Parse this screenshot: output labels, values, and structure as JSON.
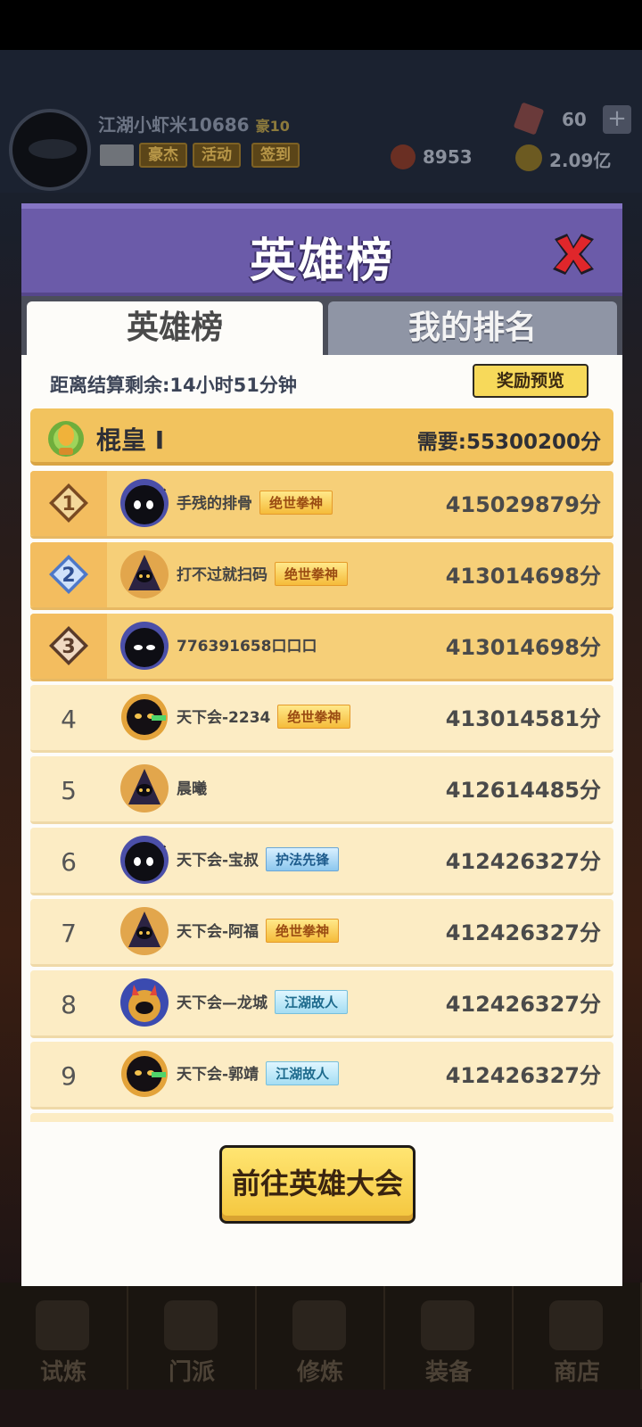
{
  "background": {
    "player_name": "江湖小虾米10686",
    "vip": "豪10",
    "tags": [
      "豪杰",
      "活动",
      "签到"
    ],
    "gems": "60",
    "red_currency": "8953",
    "gold": "2.09亿",
    "nav": [
      "试炼",
      "门派",
      "修炼",
      "装备",
      "商店"
    ]
  },
  "modal": {
    "title": "英雄榜",
    "tabs": {
      "active": "英雄榜",
      "inactive": "我的排名"
    },
    "countdown": "距离结算剩余:14小时51分钟",
    "preview_button": "奖励预览",
    "tier": {
      "name": "棍皇 I",
      "requirement": "需要:55300200分"
    },
    "rows": [
      {
        "rank": "1",
        "name": "手残的排骨",
        "title": "绝世拳神",
        "title_style": "gold",
        "score": "415029879分",
        "avatar": "ninja-question"
      },
      {
        "rank": "2",
        "name": "打不过就扫码",
        "title": "绝世拳神",
        "title_style": "gold",
        "score": "413014698分",
        "avatar": "hooded"
      },
      {
        "rank": "3",
        "name": "776391658口口口",
        "title": "",
        "title_style": "",
        "score": "413014698分",
        "avatar": "ninja"
      },
      {
        "rank": "4",
        "name": "天下会-2234",
        "title": "绝世拳神",
        "title_style": "gold",
        "score": "413014581分",
        "avatar": "golden-warrior"
      },
      {
        "rank": "5",
        "name": "晨曦",
        "title": "",
        "title_style": "",
        "score": "412614485分",
        "avatar": "hooded"
      },
      {
        "rank": "6",
        "name": "天下会-宝叔",
        "title": "护法先锋",
        "title_style": "blue",
        "score": "412426327分",
        "avatar": "ninja-question"
      },
      {
        "rank": "7",
        "name": "天下会-阿福",
        "title": "绝世拳神",
        "title_style": "gold",
        "score": "412426327分",
        "avatar": "hooded"
      },
      {
        "rank": "8",
        "name": "天下会—龙城",
        "title": "江湖故人",
        "title_style": "teal",
        "score": "412426327分",
        "avatar": "rabbit"
      },
      {
        "rank": "9",
        "name": "天下会-郭靖",
        "title": "江湖故人",
        "title_style": "teal",
        "score": "412426327分",
        "avatar": "golden-warrior"
      }
    ],
    "go_button": "前往英雄大会"
  },
  "colors": {
    "header": "#6b5ba9",
    "top_row": "#f6cf78",
    "normal_row": "#fcecc4",
    "button": "#f4c63d"
  }
}
